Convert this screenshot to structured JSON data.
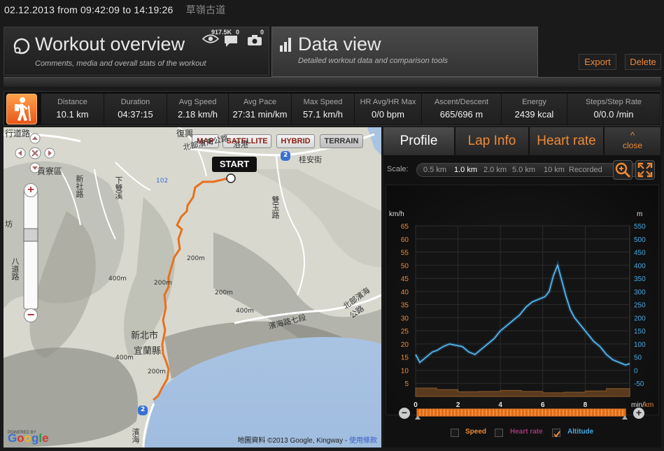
{
  "workout": {
    "date_range": "02.12.2013  from 09:42:09  to 14:19:26",
    "location": "草嶺古道"
  },
  "tabs": {
    "overview": {
      "title": "Workout overview",
      "subtitle": "Comments, media and overall stats of the workout",
      "views": "917.5K",
      "comments": "0",
      "photos": "0"
    },
    "data_view": {
      "title": "Data view",
      "subtitle": "Detailed workout data and comparison tools"
    }
  },
  "actions": {
    "export": "Export",
    "delete": "Delete"
  },
  "stats": [
    {
      "label": "Distance",
      "value": "10.1 km"
    },
    {
      "label": "Duration",
      "value": "04:37:15"
    },
    {
      "label": "Avg Speed",
      "value": "2.18 km/h"
    },
    {
      "label": "Avg Pace",
      "value": "27:31 min/km"
    },
    {
      "label": "Max Speed",
      "value": "57.1 km/h"
    },
    {
      "label": "HR Avg/HR Max",
      "value": "0/0 bpm"
    },
    {
      "label": "Ascent/Descent",
      "value": "665/696 m"
    },
    {
      "label": "Energy",
      "value": "2439 kcal"
    },
    {
      "label": "Steps/Step Rate",
      "value": "0/0.0 /min"
    }
  ],
  "map": {
    "types": [
      "MAP",
      "SATELLITE",
      "HYBRID",
      "TERRAIN"
    ],
    "active_type": "TERRAIN",
    "start_label": "START",
    "labels": {
      "place_tl": "行道路",
      "place_fuxing": "復興",
      "road_beibin": "北部濱海公路",
      "place_yugang": "浴港",
      "road_guian": "桂安街",
      "shield_2a": "2",
      "place_gongliao": "貢寮區",
      "road_jiwei": "新社路",
      "road_xiashuang": "下雙溪",
      "road_shuang": "雙玉路",
      "shield_102": "102",
      "contour_200a": "200m",
      "contour_200b": "200m",
      "contour_200c": "200m",
      "contour_200d": "200m",
      "contour_400a": "400m",
      "contour_400b": "400m",
      "contour_400c": "400m",
      "county_newtaipei": "新北市",
      "county_yilan": "宜蘭縣",
      "road_binhai7": "濱海路七段",
      "road_beibin2": "北部濱海公路",
      "road_binhai_bottom": "濱海",
      "shield_2b": "2",
      "left_road": "八道路",
      "left_fang": "坊"
    },
    "copyright": "地圖資料 ©2013 Google, Kingway - ",
    "terms": "使用條款",
    "powered_by": "POWERED BY",
    "google": "Google"
  },
  "panel": {
    "tabs": [
      "Profile",
      "Lap Info",
      "Heart rate"
    ],
    "close": "close",
    "scale_label": "Scale:",
    "scale_options": [
      "0.5 km",
      "1.0 km",
      "2.0 km",
      "5.0 km",
      "10 km",
      "Recorded"
    ],
    "scale_selected": "1.0 km",
    "legend": [
      {
        "name": "Speed",
        "checked": false,
        "color": "#ee8a37"
      },
      {
        "name": "Heart rate",
        "checked": false,
        "color": "#9b3b74"
      },
      {
        "name": "Altitude",
        "checked": true,
        "color": "#4aa8e0"
      }
    ]
  },
  "chart_data": {
    "type": "line",
    "xlabel": "min/km",
    "ylabel_left": "km/h",
    "ylabel_right": "m",
    "x_ticks": [
      0,
      2,
      4,
      6,
      8
    ],
    "y_left_ticks": [
      5,
      10,
      15,
      20,
      25,
      30,
      35,
      40,
      45,
      50,
      55,
      60,
      65
    ],
    "y_right_ticks": [
      -50,
      0,
      50,
      100,
      150,
      200,
      250,
      300,
      350,
      400,
      450,
      500,
      550
    ],
    "xlim": [
      0,
      10.1
    ],
    "ylim_left": [
      0,
      65
    ],
    "ylim_right": [
      -100,
      550
    ],
    "series": [
      {
        "name": "Altitude",
        "axis": "right",
        "x": [
          0,
          0.2,
          0.5,
          0.8,
          1.0,
          1.3,
          1.6,
          1.9,
          2.2,
          2.5,
          2.8,
          3.1,
          3.4,
          3.7,
          4.0,
          4.3,
          4.6,
          4.9,
          5.2,
          5.5,
          5.8,
          6.1,
          6.3,
          6.5,
          6.7,
          6.9,
          7.1,
          7.3,
          7.5,
          7.8,
          8.1,
          8.4,
          8.7,
          9.0,
          9.3,
          9.6,
          9.9,
          10.1
        ],
        "y": [
          60,
          30,
          50,
          70,
          75,
          90,
          100,
          95,
          90,
          70,
          60,
          80,
          100,
          120,
          150,
          170,
          190,
          210,
          240,
          260,
          270,
          280,
          300,
          360,
          400,
          340,
          280,
          230,
          200,
          170,
          140,
          110,
          90,
          60,
          40,
          30,
          20,
          25
        ]
      },
      {
        "name": "Speed",
        "axis": "left",
        "x": [
          0,
          1,
          2,
          3,
          4,
          5,
          6,
          7,
          8,
          9,
          10.1
        ],
        "y": [
          3.2,
          2.6,
          1.8,
          1.9,
          2.3,
          1.9,
          1.4,
          1.6,
          2.1,
          3.0,
          2.5
        ]
      }
    ]
  }
}
